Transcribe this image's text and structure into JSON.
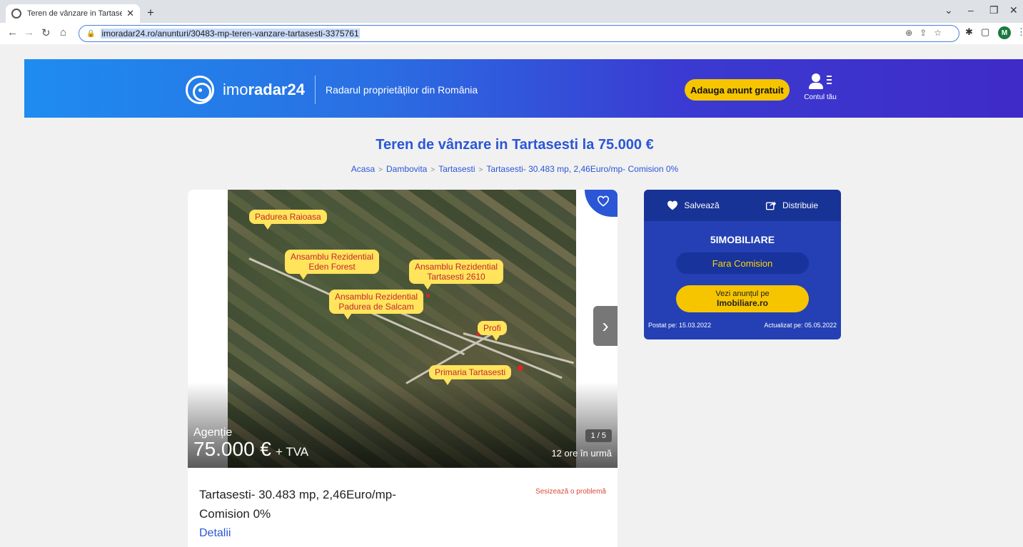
{
  "browser": {
    "tab_title": "Teren de vânzare in Tartasesti la",
    "url": "imoradar24.ro/anunturi/30483-mp-teren-vanzare-tartasesti-3375761",
    "avatar_letter": "M"
  },
  "header": {
    "logo_light": "imo",
    "logo_bold": "radar24",
    "tagline": "Radarul proprietăților din România",
    "add_button": "Adauga anunt gratuit",
    "account_label": "Contul tău"
  },
  "page": {
    "title": "Teren de vânzare in Tartasesti la 75.000 €",
    "breadcrumb": [
      "Acasa",
      "Dambovita",
      "Tartasesti",
      "Tartasesti- 30.483 mp, 2,46Euro/mp- Comision 0%"
    ]
  },
  "listing": {
    "map_labels": [
      "Padurea Raioasa",
      "Ansamblu Rezidential\nEden Forest",
      "Ansamblu Rezidential\nTartasesti 2610",
      "Ansamblu Rezidential\nPadurea de Salcam",
      "Profi",
      "Primaria Tartasesti"
    ],
    "type": "Agenție",
    "price": "75.000 €",
    "vat": "+ TVA",
    "counter": "1 / 5",
    "age": "12 ore în urmă",
    "title": "Tartasesti- 30.483 mp, 2,46Euro/mp- Comision 0%",
    "report_link": "Sesizează o problemă",
    "details_link": "Detalii"
  },
  "side": {
    "save": "Salvează",
    "share": "Distribuie",
    "agency": "5IMOBILIARE",
    "commission": "Fara Comision",
    "portal_line1": "Vezi anunțul pe",
    "portal_line2": "Imobiliare.ro",
    "posted": "Postat pe: 15.03.2022",
    "updated": "Actualizat pe: 05.05.2022"
  },
  "colors": {
    "accent": "#2b56d6",
    "button_yellow": "#f6c500",
    "panel_blue": "#2440b4"
  }
}
